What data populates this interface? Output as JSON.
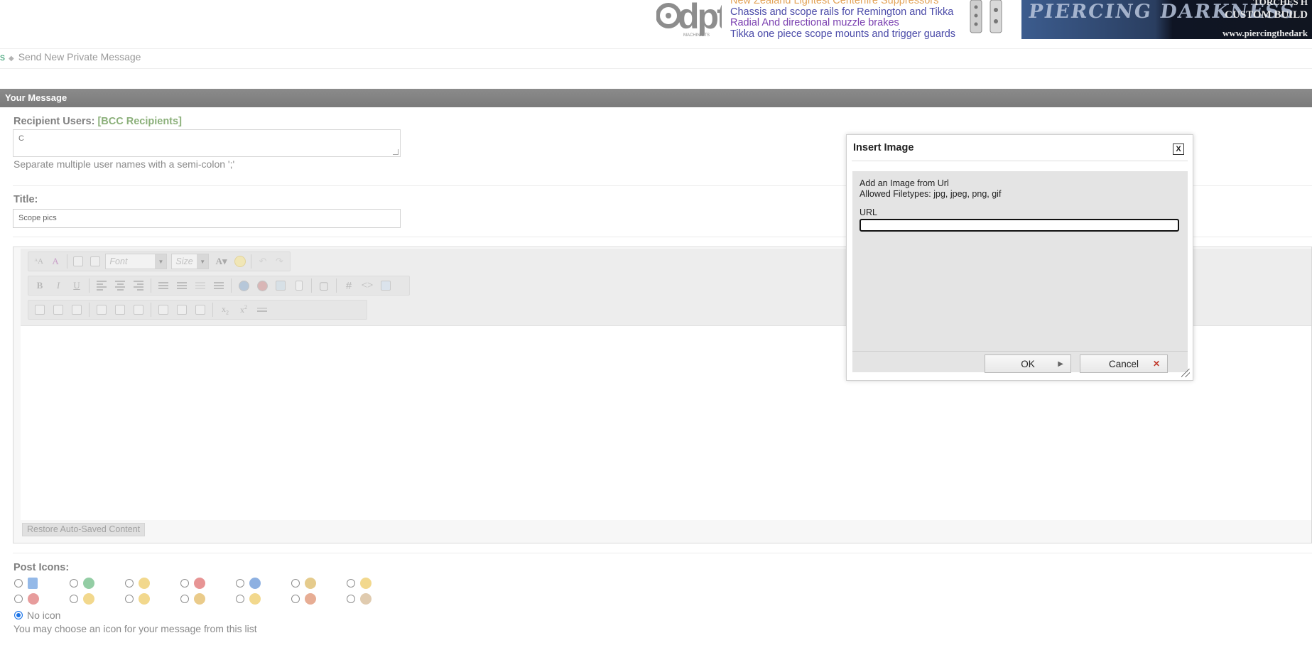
{
  "banner": {
    "dpt_ad": {
      "lines": [
        "New Zealand Lightest Centerfire Suppressors",
        "Chassis and scope rails for Remington and Tikka",
        "Radial And directional muzzle brakes",
        "Tikka one piece scope mounts and trigger guards"
      ]
    },
    "pierce_ad": {
      "word": "PIERCING DARKNESS",
      "right_line1": "TORCHES      H",
      "right_line2": "CUSTOM BUILD",
      "right_line3": "www.piercingthedark"
    }
  },
  "breadcrumb": {
    "previous": "s",
    "current": "Send New Private Message"
  },
  "message_header": "Your Message",
  "recipients": {
    "label": "Recipient Users:",
    "bcc_link": "[BCC Recipients]",
    "value": "C",
    "hint": "Separate multiple user names with a semi-colon ';'"
  },
  "title_field": {
    "label": "Title:",
    "value": "Scope pics"
  },
  "editor": {
    "font_placeholder": "Font",
    "size_placeholder": "Size",
    "restore_label": "Restore Auto-Saved Content"
  },
  "post_icons": {
    "label": "Post Icons:",
    "no_icon_label": "No icon",
    "hint": "You may choose an icon for your message from this list",
    "icon_colors": [
      "#3d7fd6",
      "#3aa45a",
      "#e8b830",
      "#d33c3c",
      "#2f6fc8",
      "#cfa02d",
      "#e8b830",
      "#d34a4a",
      "#e8b830",
      "#e8b830",
      "#d9a02a",
      "#e8b830",
      "#d36a3c",
      "#c7a06e"
    ]
  },
  "dialog": {
    "title": "Insert Image",
    "close_label": "X",
    "info_line1": "Add an Image from Url",
    "info_line2": "Allowed Filetypes: jpg, jpeg, png, gif",
    "url_label": "URL",
    "url_value": "",
    "ok_label": "OK",
    "cancel_label": "Cancel"
  }
}
